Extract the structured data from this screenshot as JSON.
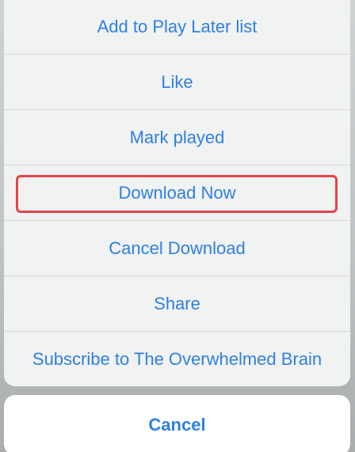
{
  "action_sheet": {
    "actions": [
      {
        "label": "Add to Play Later list"
      },
      {
        "label": "Like"
      },
      {
        "label": "Mark played"
      },
      {
        "label": "Download Now",
        "highlighted": true
      },
      {
        "label": "Cancel Download"
      },
      {
        "label": "Share"
      },
      {
        "label": "Subscribe to The Overwhelmed Brain"
      }
    ],
    "cancel_label": "Cancel"
  },
  "colors": {
    "action_text": "#2f80e0",
    "highlight_border": "#e5444a",
    "sheet_background": "#f1f2f2",
    "cancel_background": "#ffffff"
  }
}
